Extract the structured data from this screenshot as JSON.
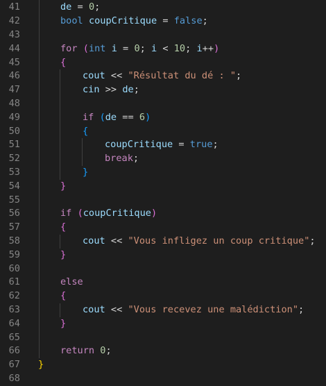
{
  "editor": {
    "lines": [
      {
        "n": "41",
        "indent": 1,
        "tokens": [
          [
            "var",
            "de"
          ],
          [
            "op",
            " = "
          ],
          [
            "num",
            "0"
          ],
          [
            "op",
            ";"
          ]
        ]
      },
      {
        "n": "42",
        "indent": 1,
        "tokens": [
          [
            "kw",
            "bool"
          ],
          [
            "op",
            " "
          ],
          [
            "var",
            "coupCritique"
          ],
          [
            "op",
            " = "
          ],
          [
            "kw",
            "false"
          ],
          [
            "op",
            ";"
          ]
        ]
      },
      {
        "n": "43",
        "indent": 0,
        "tokens": []
      },
      {
        "n": "44",
        "indent": 1,
        "tokens": [
          [
            "ctrl",
            "for"
          ],
          [
            "op",
            " "
          ],
          [
            "b2",
            "("
          ],
          [
            "kw",
            "int"
          ],
          [
            "op",
            " "
          ],
          [
            "var",
            "i"
          ],
          [
            "op",
            " = "
          ],
          [
            "num",
            "0"
          ],
          [
            "op",
            "; "
          ],
          [
            "var",
            "i"
          ],
          [
            "op",
            " < "
          ],
          [
            "num",
            "10"
          ],
          [
            "op",
            "; "
          ],
          [
            "var",
            "i"
          ],
          [
            "op",
            "++"
          ],
          [
            "b2",
            ")"
          ]
        ]
      },
      {
        "n": "45",
        "indent": 1,
        "tokens": [
          [
            "b2",
            "{"
          ]
        ]
      },
      {
        "n": "46",
        "indent": 2,
        "tokens": [
          [
            "var",
            "cout"
          ],
          [
            "op",
            " << "
          ],
          [
            "str",
            "\"Résultat du dé : \""
          ],
          [
            "op",
            ";"
          ]
        ]
      },
      {
        "n": "47",
        "indent": 2,
        "tokens": [
          [
            "var",
            "cin"
          ],
          [
            "op",
            " >> "
          ],
          [
            "var",
            "de"
          ],
          [
            "op",
            ";"
          ]
        ]
      },
      {
        "n": "48",
        "indent": 0,
        "tokens": []
      },
      {
        "n": "49",
        "indent": 2,
        "tokens": [
          [
            "ctrl",
            "if"
          ],
          [
            "op",
            " "
          ],
          [
            "b3",
            "("
          ],
          [
            "var",
            "de"
          ],
          [
            "op",
            " == "
          ],
          [
            "num",
            "6"
          ],
          [
            "b3",
            ")"
          ]
        ]
      },
      {
        "n": "50",
        "indent": 2,
        "tokens": [
          [
            "b3",
            "{"
          ]
        ]
      },
      {
        "n": "51",
        "indent": 3,
        "tokens": [
          [
            "var",
            "coupCritique"
          ],
          [
            "op",
            " = "
          ],
          [
            "kw",
            "true"
          ],
          [
            "op",
            ";"
          ]
        ]
      },
      {
        "n": "52",
        "indent": 3,
        "tokens": [
          [
            "ctrl",
            "break"
          ],
          [
            "op",
            ";"
          ]
        ]
      },
      {
        "n": "53",
        "indent": 2,
        "tokens": [
          [
            "b3",
            "}"
          ]
        ]
      },
      {
        "n": "54",
        "indent": 1,
        "tokens": [
          [
            "b2",
            "}"
          ]
        ]
      },
      {
        "n": "55",
        "indent": 0,
        "tokens": []
      },
      {
        "n": "56",
        "indent": 1,
        "tokens": [
          [
            "ctrl",
            "if"
          ],
          [
            "op",
            " "
          ],
          [
            "b2",
            "("
          ],
          [
            "var",
            "coupCritique"
          ],
          [
            "b2",
            ")"
          ]
        ]
      },
      {
        "n": "57",
        "indent": 1,
        "tokens": [
          [
            "b2",
            "{"
          ]
        ]
      },
      {
        "n": "58",
        "indent": 2,
        "tokens": [
          [
            "var",
            "cout"
          ],
          [
            "op",
            " << "
          ],
          [
            "str",
            "\"Vous infligez un coup critique\""
          ],
          [
            "op",
            ";"
          ]
        ]
      },
      {
        "n": "59",
        "indent": 1,
        "tokens": [
          [
            "b2",
            "}"
          ]
        ]
      },
      {
        "n": "60",
        "indent": 0,
        "tokens": []
      },
      {
        "n": "61",
        "indent": 1,
        "tokens": [
          [
            "ctrl",
            "else"
          ]
        ]
      },
      {
        "n": "62",
        "indent": 1,
        "tokens": [
          [
            "b2",
            "{"
          ]
        ]
      },
      {
        "n": "63",
        "indent": 2,
        "tokens": [
          [
            "var",
            "cout"
          ],
          [
            "op",
            " << "
          ],
          [
            "str",
            "\"Vous recevez une malédiction\""
          ],
          [
            "op",
            ";"
          ]
        ]
      },
      {
        "n": "64",
        "indent": 1,
        "tokens": [
          [
            "b2",
            "}"
          ]
        ]
      },
      {
        "n": "65",
        "indent": 0,
        "tokens": []
      },
      {
        "n": "66",
        "indent": 1,
        "tokens": [
          [
            "ctrl",
            "return"
          ],
          [
            "op",
            " "
          ],
          [
            "num",
            "0"
          ],
          [
            "op",
            ";"
          ]
        ]
      },
      {
        "n": "67",
        "indent": 0,
        "tokens": [
          [
            "b1",
            "}"
          ]
        ]
      },
      {
        "n": "68",
        "indent": 0,
        "tokens": []
      }
    ],
    "colors": {
      "background": "#1e1e1e",
      "line_number": "#858585",
      "keyword": "#569cd6",
      "control": "#c586c0",
      "variable": "#9cdcfe",
      "number": "#b5cea8",
      "string": "#ce9178",
      "operator": "#d4d4d4",
      "bracket_level1": "#ffd700",
      "bracket_level2": "#da70d6",
      "bracket_level3": "#179fff"
    }
  }
}
